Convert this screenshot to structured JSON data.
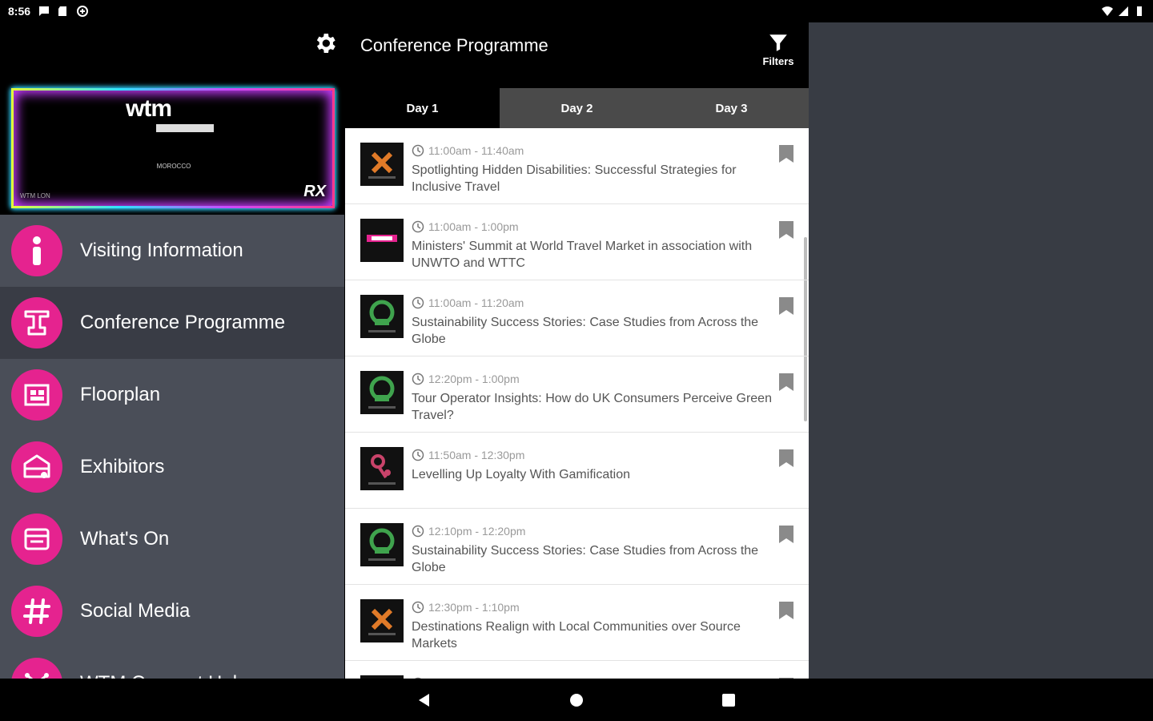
{
  "status_bar": {
    "time": "8:56"
  },
  "sidebar": {
    "banner": {
      "logo_text": "wtm",
      "rx_text": "RX",
      "left_text": "WTM LON",
      "mid_text": "MOROCCO"
    },
    "items": [
      {
        "label": "Visiting Information",
        "icon": "info-icon"
      },
      {
        "label": "Conference Programme",
        "icon": "podium-icon",
        "active": true
      },
      {
        "label": "Floorplan",
        "icon": "floorplan-icon"
      },
      {
        "label": "Exhibitors",
        "icon": "exhibitors-icon"
      },
      {
        "label": "What's On",
        "icon": "calendar-icon"
      },
      {
        "label": "Social Media",
        "icon": "hashtag-icon"
      },
      {
        "label": "WTM Connect Hub",
        "icon": "network-icon"
      }
    ]
  },
  "header": {
    "title": "Conference Programme",
    "filters_label": "Filters"
  },
  "tabs": [
    {
      "label": "Day 1",
      "active": true
    },
    {
      "label": "Day 2"
    },
    {
      "label": "Day 3"
    }
  ],
  "sessions": [
    {
      "time": "11:00am - 11:40am",
      "title": "Spotlighting Hidden Disabilities: Successful Strategies for Inclusive Travel",
      "thumb": "orange-x"
    },
    {
      "time": "11:00am - 1:00pm",
      "title": "Ministers' Summit at World Travel Market in association with UNWTO and WTTC",
      "thumb": "wtm"
    },
    {
      "time": "11:00am - 11:20am",
      "title": "Sustainability Success Stories: Case Studies from Across the Globe",
      "thumb": "green"
    },
    {
      "time": "12:20pm - 1:00pm",
      "title": "Tour Operator Insights: How do UK Consumers Perceive Green Travel?",
      "thumb": "green"
    },
    {
      "time": "11:50am - 12:30pm",
      "title": "Levelling Up Loyalty With Gamification",
      "thumb": "pink"
    },
    {
      "time": "12:10pm - 12:20pm",
      "title": "Sustainability Success Stories: Case Studies from Across the Globe",
      "thumb": "green"
    },
    {
      "time": "12:30pm - 1:10pm",
      "title": "Destinations Realign with Local Communities over Source Markets",
      "thumb": "orange-x"
    },
    {
      "time": "",
      "title": "",
      "thumb": "wtm"
    }
  ]
}
